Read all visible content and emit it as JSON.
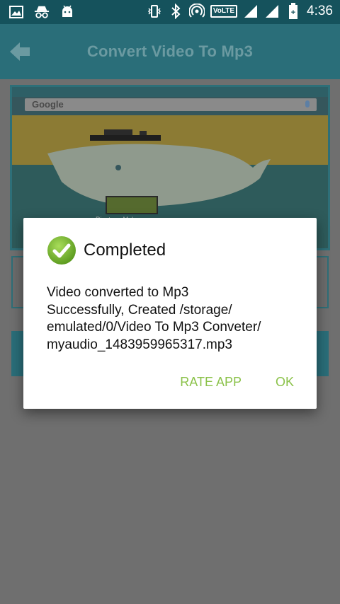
{
  "status_bar": {
    "time": "4:36",
    "volte_label": "VoLTE",
    "icons": [
      "image-icon",
      "incognito-icon",
      "android-icon",
      "vibrate-icon",
      "bluetooth-icon",
      "hotspot-icon",
      "volte-icon",
      "signal-icon",
      "signal-icon-2",
      "battery-icon"
    ]
  },
  "app_bar": {
    "title": "Convert Video To Mp3",
    "back_icon": "back-arrow-icon"
  },
  "preview": {
    "search_text": "Google",
    "app_label": "Ringtone Make"
  },
  "dialog": {
    "title": "Completed",
    "message": "Video converted to Mp3 Successfully, Created /storage/emulated/0/Video To Mp3 Conveter/myaudio_1483959965317.mp3",
    "message_lines": [
      "Video converted to Mp3",
      "Successfully, Created /storage/",
      "emulated/0/Video To Mp3 Conveter/",
      "myaudio_1483959965317.mp3"
    ],
    "buttons": {
      "rate": "RATE APP",
      "ok": "OK"
    },
    "accent_color": "#8bc24a",
    "icon": "check-circle-icon"
  },
  "colors": {
    "status_bar": "#15525c",
    "app_bar": "#2a6e79",
    "scrim": "#6f6f6f"
  }
}
